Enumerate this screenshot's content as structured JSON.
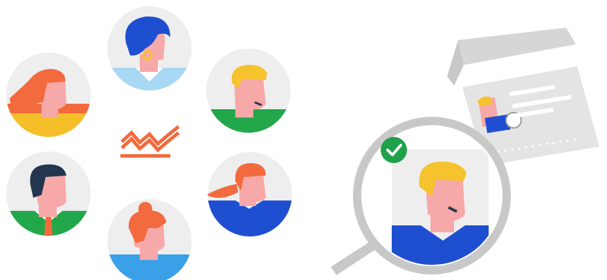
{
  "illustration": {
    "avatars": [
      {
        "id": "curly-hair-woman",
        "hair": "#1f4fd1",
        "shirt": "#a9d8f5",
        "skin": "#f7a8a8"
      },
      {
        "id": "blonde-man",
        "hair": "#f6c22e",
        "shirt": "#22a84a",
        "skin": "#f7a8a8"
      },
      {
        "id": "ponytail-woman",
        "hair": "#f26a3d",
        "shirt": "#1f4fd1",
        "skin": "#f7a8a8"
      },
      {
        "id": "bun-woman",
        "hair": "#f26a3d",
        "shirt": "#3aa0e8",
        "skin": "#f7a8a8"
      },
      {
        "id": "dark-hair-man",
        "hair": "#24364f",
        "shirt": "#22a84a",
        "skin": "#f7a8a8"
      },
      {
        "id": "redhead-woman",
        "hair": "#f26a3d",
        "shirt": "#f5bf2a",
        "skin": "#f7a8a8"
      }
    ],
    "colors": {
      "accent_orange": "#f26a3d",
      "check_green": "#20a04b",
      "circle_gray": "#eeeeee",
      "magnifier_gray": "#c8c8c8",
      "card_gray": "#e4e4e4"
    },
    "icons": [
      "zigzag-trend-icon",
      "magnifying-glass-icon",
      "check-badge-icon",
      "id-card-icon"
    ]
  }
}
